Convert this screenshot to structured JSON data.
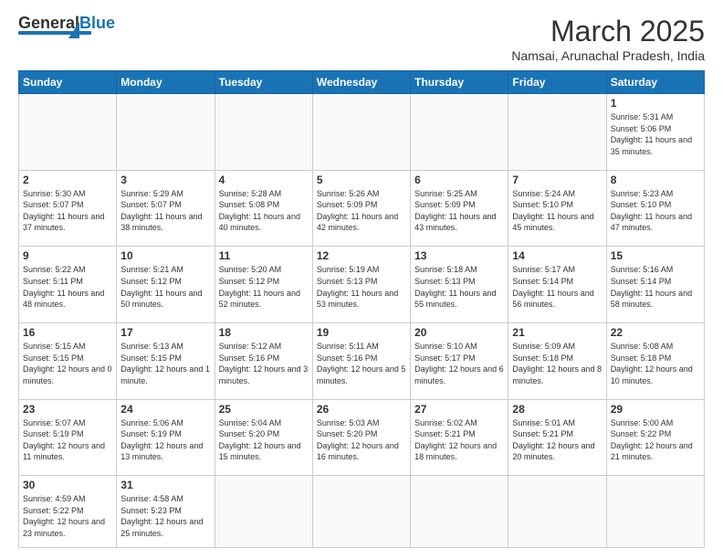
{
  "header": {
    "logo_general": "General",
    "logo_blue": "Blue",
    "month_year": "March 2025",
    "subtitle": "Namsai, Arunachal Pradesh, India"
  },
  "days_of_week": [
    "Sunday",
    "Monday",
    "Tuesday",
    "Wednesday",
    "Thursday",
    "Friday",
    "Saturday"
  ],
  "weeks": [
    [
      {
        "day": "",
        "info": ""
      },
      {
        "day": "",
        "info": ""
      },
      {
        "day": "",
        "info": ""
      },
      {
        "day": "",
        "info": ""
      },
      {
        "day": "",
        "info": ""
      },
      {
        "day": "",
        "info": ""
      },
      {
        "day": "1",
        "info": "Sunrise: 5:31 AM\nSunset: 5:06 PM\nDaylight: 11 hours and 35 minutes."
      }
    ],
    [
      {
        "day": "2",
        "info": "Sunrise: 5:30 AM\nSunset: 5:07 PM\nDaylight: 11 hours and 37 minutes."
      },
      {
        "day": "3",
        "info": "Sunrise: 5:29 AM\nSunset: 5:07 PM\nDaylight: 11 hours and 38 minutes."
      },
      {
        "day": "4",
        "info": "Sunrise: 5:28 AM\nSunset: 5:08 PM\nDaylight: 11 hours and 40 minutes."
      },
      {
        "day": "5",
        "info": "Sunrise: 5:26 AM\nSunset: 5:09 PM\nDaylight: 11 hours and 42 minutes."
      },
      {
        "day": "6",
        "info": "Sunrise: 5:25 AM\nSunset: 5:09 PM\nDaylight: 11 hours and 43 minutes."
      },
      {
        "day": "7",
        "info": "Sunrise: 5:24 AM\nSunset: 5:10 PM\nDaylight: 11 hours and 45 minutes."
      },
      {
        "day": "8",
        "info": "Sunrise: 5:23 AM\nSunset: 5:10 PM\nDaylight: 11 hours and 47 minutes."
      }
    ],
    [
      {
        "day": "9",
        "info": "Sunrise: 5:22 AM\nSunset: 5:11 PM\nDaylight: 11 hours and 48 minutes."
      },
      {
        "day": "10",
        "info": "Sunrise: 5:21 AM\nSunset: 5:12 PM\nDaylight: 11 hours and 50 minutes."
      },
      {
        "day": "11",
        "info": "Sunrise: 5:20 AM\nSunset: 5:12 PM\nDaylight: 11 hours and 52 minutes."
      },
      {
        "day": "12",
        "info": "Sunrise: 5:19 AM\nSunset: 5:13 PM\nDaylight: 11 hours and 53 minutes."
      },
      {
        "day": "13",
        "info": "Sunrise: 5:18 AM\nSunset: 5:13 PM\nDaylight: 11 hours and 55 minutes."
      },
      {
        "day": "14",
        "info": "Sunrise: 5:17 AM\nSunset: 5:14 PM\nDaylight: 11 hours and 56 minutes."
      },
      {
        "day": "15",
        "info": "Sunrise: 5:16 AM\nSunset: 5:14 PM\nDaylight: 11 hours and 58 minutes."
      }
    ],
    [
      {
        "day": "16",
        "info": "Sunrise: 5:15 AM\nSunset: 5:15 PM\nDaylight: 12 hours and 0 minutes."
      },
      {
        "day": "17",
        "info": "Sunrise: 5:13 AM\nSunset: 5:15 PM\nDaylight: 12 hours and 1 minute."
      },
      {
        "day": "18",
        "info": "Sunrise: 5:12 AM\nSunset: 5:16 PM\nDaylight: 12 hours and 3 minutes."
      },
      {
        "day": "19",
        "info": "Sunrise: 5:11 AM\nSunset: 5:16 PM\nDaylight: 12 hours and 5 minutes."
      },
      {
        "day": "20",
        "info": "Sunrise: 5:10 AM\nSunset: 5:17 PM\nDaylight: 12 hours and 6 minutes."
      },
      {
        "day": "21",
        "info": "Sunrise: 5:09 AM\nSunset: 5:18 PM\nDaylight: 12 hours and 8 minutes."
      },
      {
        "day": "22",
        "info": "Sunrise: 5:08 AM\nSunset: 5:18 PM\nDaylight: 12 hours and 10 minutes."
      }
    ],
    [
      {
        "day": "23",
        "info": "Sunrise: 5:07 AM\nSunset: 5:19 PM\nDaylight: 12 hours and 11 minutes."
      },
      {
        "day": "24",
        "info": "Sunrise: 5:06 AM\nSunset: 5:19 PM\nDaylight: 12 hours and 13 minutes."
      },
      {
        "day": "25",
        "info": "Sunrise: 5:04 AM\nSunset: 5:20 PM\nDaylight: 12 hours and 15 minutes."
      },
      {
        "day": "26",
        "info": "Sunrise: 5:03 AM\nSunset: 5:20 PM\nDaylight: 12 hours and 16 minutes."
      },
      {
        "day": "27",
        "info": "Sunrise: 5:02 AM\nSunset: 5:21 PM\nDaylight: 12 hours and 18 minutes."
      },
      {
        "day": "28",
        "info": "Sunrise: 5:01 AM\nSunset: 5:21 PM\nDaylight: 12 hours and 20 minutes."
      },
      {
        "day": "29",
        "info": "Sunrise: 5:00 AM\nSunset: 5:22 PM\nDaylight: 12 hours and 21 minutes."
      }
    ],
    [
      {
        "day": "30",
        "info": "Sunrise: 4:59 AM\nSunset: 5:22 PM\nDaylight: 12 hours and 23 minutes."
      },
      {
        "day": "31",
        "info": "Sunrise: 4:58 AM\nSunset: 5:23 PM\nDaylight: 12 hours and 25 minutes."
      },
      {
        "day": "",
        "info": ""
      },
      {
        "day": "",
        "info": ""
      },
      {
        "day": "",
        "info": ""
      },
      {
        "day": "",
        "info": ""
      },
      {
        "day": "",
        "info": ""
      }
    ]
  ]
}
